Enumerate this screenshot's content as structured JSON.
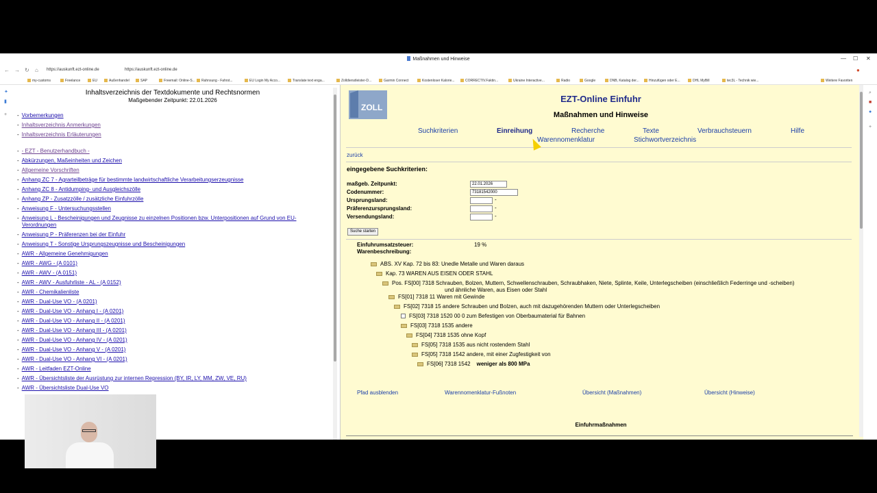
{
  "window": {
    "title": "Maßnahmen und Hinweise"
  },
  "address": {
    "url1": "https://auskunft.ezt-online.de",
    "url2": "https://auskunft.ezt-online.de"
  },
  "bookmarks": [
    "my-customs",
    "Freelance",
    "EU",
    "Außenhandel",
    "SAP",
    "Freemail: Online-S...",
    "Rahnsung - Fahrst...",
    "EU Login My Acco...",
    "Translate text enga...",
    "Zolldienstleister-D...",
    "Garmin Connect",
    "Kostenloser Kalorie...",
    "CORRECTIV.Faktin...",
    "Ukraine Interactive...",
    "Radio",
    "Google",
    "DNB, Katalog der...",
    "Hinzufügen oder E...",
    "DHL MyBill",
    "tec3L - Technik wie...",
    "Weitere Favoriten"
  ],
  "left": {
    "title": "Inhaltsverzeichnis der Textdokumente und Rechtsnormen",
    "subtitle": "Maßgebender Zeitpunkt: 22.01.2026",
    "links": [
      "Vorbemerkungen",
      "Inhaltsverzeichnis Anmerkungen",
      "Inhaltsverzeichnis Erläuterungen",
      "- EZT - Benutzerhandbuch -",
      "Abkürzungen, Maßeinheiten und Zeichen",
      "Allgemeine Vorschriften",
      "Anhang ZC 7 - Agrarteilbeträge für bestimmte landwirtschaftliche Verarbeitungserzeugnisse",
      "Anhang ZC 8 - Antidumping- und Ausgleichszölle",
      "Anhang ZP - Zusatzzölle / zusätzliche Einfuhrzölle",
      "Anweisung F - Untersuchungsstellen",
      "Anweisung L - Bescheinigungen und Zeugnisse zu einzelnen Positionen bzw. Unterpositionen auf Grund von EU-",
      "Verordnungen",
      "Anweisung P - Präferenzen bei der Einfuhr",
      "Anweisung T - Sonstige Ursprungszeugnisse und Bescheinigungen",
      "AWR - Allgemeine Genehmigungen",
      "AWR - AWG - (A 0101)",
      "AWR - AWV - (A 0151)",
      "AWR - AWV - Ausfuhrliste - AL - (A 0152)",
      "AWR - Chemikalienliste",
      "AWR - Dual-Use VO - (A 0201)",
      "AWR - Dual-Use VO - Anhang I - (A 0201)",
      "AWR - Dual-Use VO - Anhang II - (A 0201)",
      "AWR - Dual-Use VO - Anhang III - (A 0201)",
      "AWR - Dual-Use VO - Anhang IV - (A 0201)",
      "AWR - Dual-Use VO - Anhang V - (A 0201)",
      "AWR - Dual-Use VO - Anhang VI - (A 0201)",
      "AWR - Leitfaden EZT-Online",
      "AWR - Übersichtsliste der Ausrüstung zur internen Repression (BY, IR, LY, MM, ZW, VE, RU)",
      "AWR - Übersichtsliste Dual-Use VO"
    ]
  },
  "right": {
    "logo_text": "ZOLL",
    "app_title": "EZT-Online Einfuhr",
    "page_title": "Maßnahmen und Hinweise",
    "nav": {
      "suchkriterien": "Suchkriterien",
      "einreihung": "Einreihung",
      "recherche": "Recherche",
      "texte": "Texte",
      "verbrauchsteuern": "Verbrauchsteuern",
      "hilfe": "Hilfe",
      "warennomenklatur": "Warennomenklatur",
      "stichwortverzeichnis": "Stichwortverzeichnis"
    },
    "back": "zurück",
    "criteria_title": "eingegebene Suchkriterien:",
    "fields": {
      "zeitpunkt_label": "maßgeb. Zeitpunkt:",
      "zeitpunkt_value": "22.01.2026",
      "code_label": "Codenummer:",
      "code_value": "73181542000",
      "ursprung_label": "Ursprungsland:",
      "praef_label": "Präferenzursprungsland:",
      "versendung_label": "Versendungsland:",
      "dash": "-"
    },
    "search_button": "Suche starten",
    "tax_label": "Einfuhrumsatzsteuer:",
    "tax_value": "19 %",
    "desc_label": "Warenbeschreibung:",
    "tree": [
      "ABS. XV   Kap. 72 bis 83: Unedle Metalle und Waren daraus",
      "Kap. 73   WAREN AUS EISEN ODER STAHL",
      "Pos. FS[00] 7318   Schrauben, Bolzen, Muttern, Schwellenschrauben, Schraubhaken, Niete, Splinte, Keile, Unterlegscheiben (einschließlich Federringe und -scheiben)",
      "und ähnliche Waren, aus Eisen oder Stahl",
      "FS[01] 7318 11   Waren mit Gewinde",
      "FS[02] 7318 15   andere Schrauben und Bolzen, auch mit dazugehörenden Muttern oder Unterlegscheiben",
      "FS[03] 7318 1520 00 0   zum Befestigen von Oberbaumaterial für Bahnen",
      "FS[03] 7318 1535   andere",
      "FS[04] 7318 1535   ohne Kopf",
      "FS[05] 7318 1535   aus nicht rostendem Stahl",
      "FS[05] 7318 1542   andere, mit einer Zugfestigkeit von",
      "FS[06] 7318 1542",
      "weniger als 800 MPa"
    ],
    "bottom_links": {
      "pfad": "Pfad ausblenden",
      "fussnoten": "Warennomenklatur-Fußnoten",
      "massnahmen": "Übersicht (Maßnahmen)",
      "hinweise": "Übersicht (Hinweise)"
    },
    "einfuhr_title": "Einfuhrmaßnahmen"
  }
}
